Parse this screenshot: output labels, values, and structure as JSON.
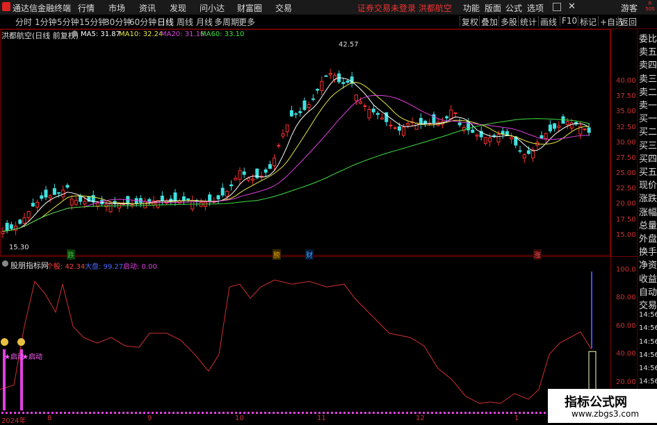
{
  "titlebar": {
    "app_name": "通达信金融终端",
    "menus": [
      "行情",
      "市场",
      "资讯",
      "发现",
      "问小达",
      "财富圈",
      "交易"
    ],
    "notice": "证券交易未登录",
    "stock_name": "洪都航空",
    "right_menus": [
      "功能",
      "版面",
      "公式",
      "选项"
    ],
    "user": "游客",
    "corner": "R 500"
  },
  "toolbar": {
    "periods": [
      "分时",
      "1分钟",
      "5分钟",
      "15分钟",
      "30分钟",
      "60分钟",
      "日线",
      "周线",
      "月线",
      "多周期",
      "更多"
    ],
    "active_period": "日线",
    "buttons": [
      "复权",
      "叠加",
      "多股",
      "统计",
      "画线",
      "F10",
      "标记",
      "+自选",
      "返回"
    ]
  },
  "main_chart": {
    "title": "洪都航空(日线 前复权)",
    "ma_labels": [
      {
        "text": "MA5: 31.87",
        "color": "#ffffff"
      },
      {
        "text": "MA10: 32.24",
        "color": "#e8e84a"
      },
      {
        "text": "MA20: 31.16",
        "color": "#e040e0"
      },
      {
        "text": "MA60: 33.10",
        "color": "#40e040"
      }
    ],
    "high_label": "42.57",
    "low_label": "15.30",
    "yticks": [
      "40.00",
      "37.50",
      "35.00",
      "32.50",
      "30.00",
      "27.50",
      "25.00",
      "22.50",
      "20.00",
      "17.50",
      "15.00"
    ],
    "events": [
      {
        "text": "跌",
        "color": "#40c040",
        "bg": "#0a3a0a"
      },
      {
        "text": "膀",
        "color": "#e0a000",
        "bg": "#3a2a00"
      },
      {
        "text": "财",
        "color": "#4aa0ff",
        "bg": "#001a3a"
      },
      {
        "text": "涨",
        "color": "#ff5050",
        "bg": "#3a0a0a"
      }
    ]
  },
  "sub_chart": {
    "title": "股朋指标网",
    "labels": [
      {
        "text": "个股: 42.34",
        "color": "#ff4040"
      },
      {
        "text": "大盘: 99.27",
        "color": "#4a6aff"
      },
      {
        "text": "启动: 0.00",
        "color": "#e040e0"
      }
    ],
    "yticks": [
      "100.0",
      "80.00",
      "60.00",
      "40.00",
      "20.00"
    ],
    "start_markers": [
      "★启动",
      "★启动"
    ]
  },
  "sidebar_items": [
    "委比",
    "卖五",
    "卖四",
    "卖三",
    "卖二",
    "卖一",
    "买一",
    "买二",
    "买三",
    "买四",
    "买五",
    "现价",
    "涨跌",
    "涨幅",
    "总量",
    "外盘",
    "换手",
    "净资",
    "收益",
    "自动",
    "交易",
    "14:56",
    "14:56",
    "14:56",
    "14:56",
    "14:56",
    "14:56",
    "14:56",
    "14:56"
  ],
  "xaxis": [
    "2024年",
    "8",
    "9",
    "10",
    "11",
    "12",
    "1"
  ],
  "watermark": {
    "line1": "指标公式网",
    "line2": "www.zbgs3.com"
  },
  "colors": {
    "up": "#ff3030",
    "down": "#40e0e0",
    "grid": "#7a0000"
  }
}
